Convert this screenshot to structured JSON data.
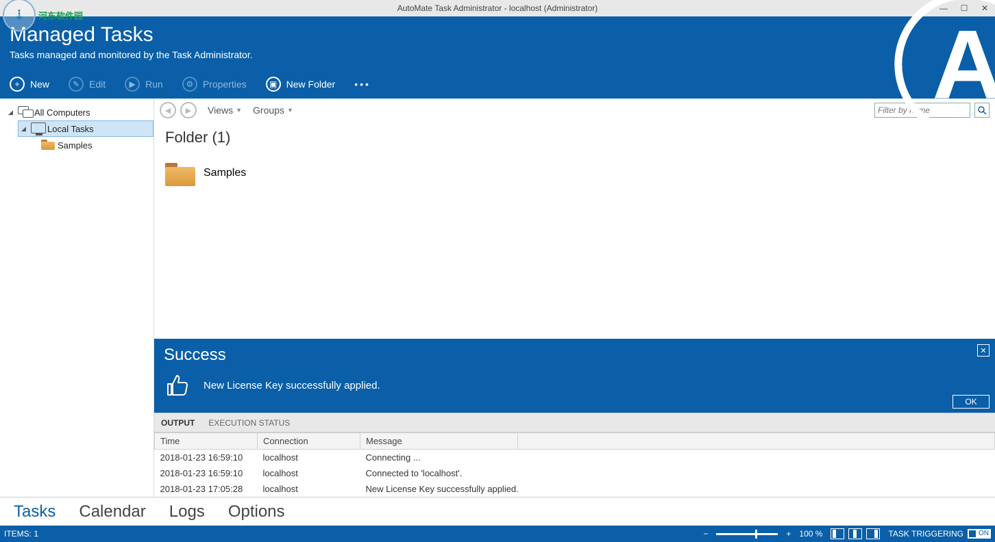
{
  "window": {
    "title": "AutoMate Task Administrator - localhost (Administrator)"
  },
  "watermark": {
    "text": "河东软件园"
  },
  "header": {
    "title": "Managed Tasks",
    "subtitle": "Tasks managed and monitored by the Task Administrator.",
    "buttons": {
      "new": "New",
      "edit": "Edit",
      "run": "Run",
      "properties": "Properties",
      "newfolder": "New Folder"
    }
  },
  "tree": {
    "root": "All Computers",
    "child": "Local Tasks",
    "grandchild": "Samples"
  },
  "subbar": {
    "views": "Views",
    "groups": "Groups",
    "filter_placeholder": "Filter by name"
  },
  "content": {
    "heading": "Folder (1)",
    "folder_name": "Samples"
  },
  "banner": {
    "title": "Success",
    "message": "New License Key successfully applied.",
    "ok": "OK"
  },
  "output": {
    "tabs": {
      "output": "OUTPUT",
      "exec": "EXECUTION STATUS"
    },
    "cols": {
      "time": "Time",
      "connection": "Connection",
      "message": "Message"
    },
    "rows": [
      {
        "time": "2018-01-23 16:59:10",
        "conn": "localhost",
        "msg": "Connecting ..."
      },
      {
        "time": "2018-01-23 16:59:10",
        "conn": "localhost",
        "msg": "Connected to 'localhost'."
      },
      {
        "time": "2018-01-23 17:05:28",
        "conn": "localhost",
        "msg": "New License Key successfully applied."
      }
    ]
  },
  "bottomnav": {
    "tasks": "Tasks",
    "calendar": "Calendar",
    "logs": "Logs",
    "options": "Options"
  },
  "status": {
    "items": "ITEMS: 1",
    "zoom": "100 %",
    "trigger": "TASK TRIGGERING",
    "on": "ON"
  }
}
